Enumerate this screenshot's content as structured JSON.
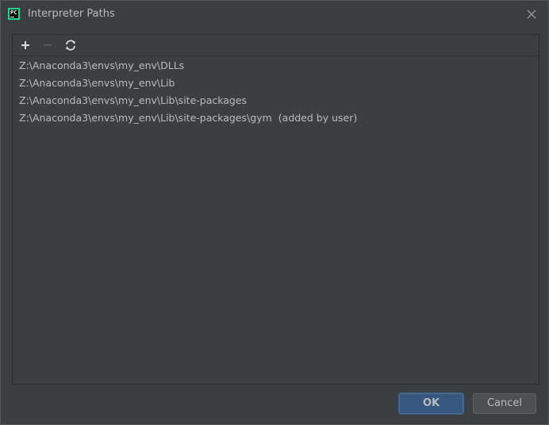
{
  "window": {
    "title": "Interpreter Paths",
    "icon": "pycharm-icon",
    "icon_text": "PC"
  },
  "toolbar": {
    "add_icon": "plus-icon",
    "remove_icon": "minus-icon",
    "reload_icon": "refresh-icon"
  },
  "paths": [
    {
      "path": "Z:\\Anaconda3\\envs\\my_env\\DLLs",
      "suffix": ""
    },
    {
      "path": "Z:\\Anaconda3\\envs\\my_env\\Lib",
      "suffix": ""
    },
    {
      "path": "Z:\\Anaconda3\\envs\\my_env\\Lib\\site-packages",
      "suffix": ""
    },
    {
      "path": "Z:\\Anaconda3\\envs\\my_env\\Lib\\site-packages\\gym",
      "suffix": "(added by user)"
    }
  ],
  "buttons": {
    "ok_label": "OK",
    "cancel_label": "Cancel"
  },
  "colors": {
    "background": "#3c3f41",
    "text": "#bbbbbb",
    "primary_button": "#365880",
    "secondary_button": "#4c5052",
    "icon_accent": "#21d789"
  }
}
